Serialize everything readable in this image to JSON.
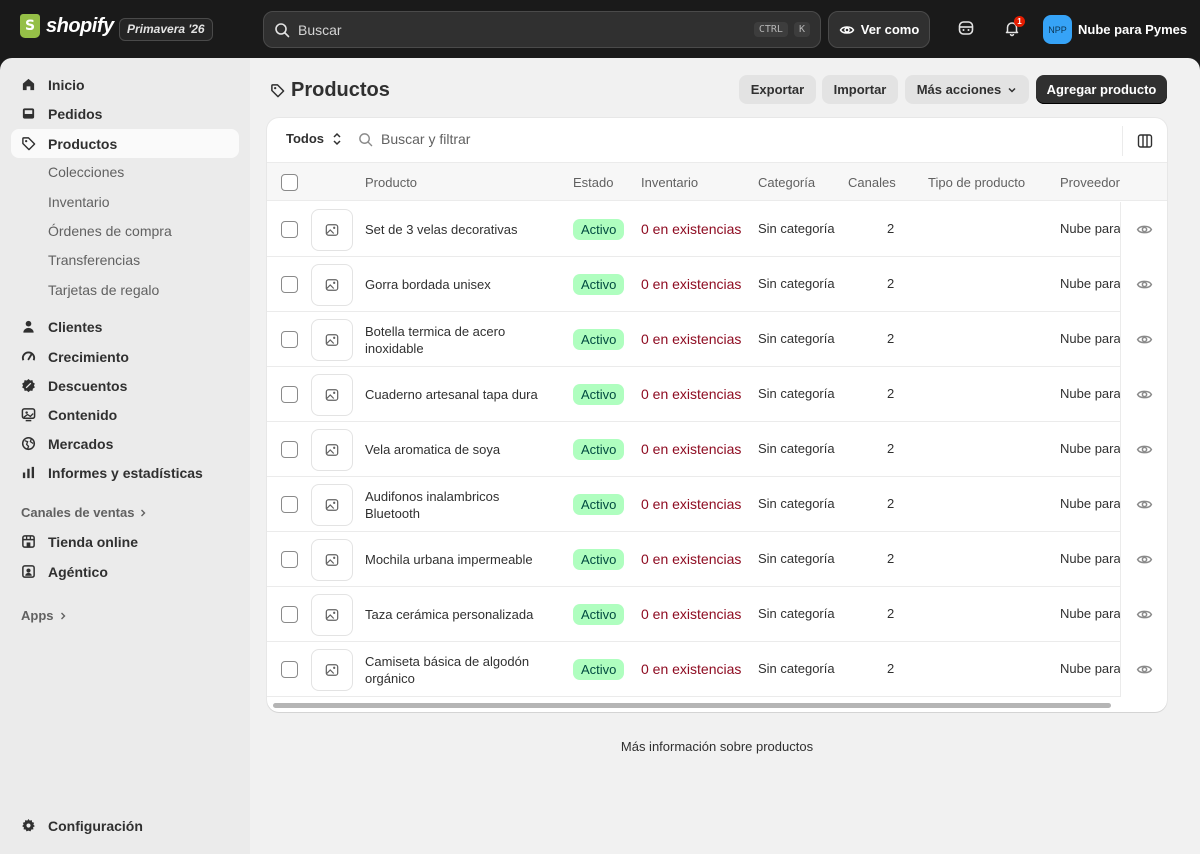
{
  "topbar": {
    "brand": "shopify",
    "edition": "Primavera '26",
    "search_placeholder": "Buscar",
    "shortcut_ctrl": "CTRL",
    "shortcut_k": "K",
    "view_as_label": "Ver como",
    "notification_count": "1",
    "store_initials": "NPP",
    "store_name": "Nube para Pymes"
  },
  "sidebar": {
    "items": [
      {
        "label": "Inicio",
        "icon": "home-icon"
      },
      {
        "label": "Pedidos",
        "icon": "inbox-icon"
      },
      {
        "label": "Productos",
        "icon": "tag-icon"
      },
      {
        "label": "Clientes",
        "icon": "person-icon"
      },
      {
        "label": "Crecimiento",
        "icon": "gauge-icon"
      },
      {
        "label": "Descuentos",
        "icon": "discount-icon"
      },
      {
        "label": "Contenido",
        "icon": "content-icon"
      },
      {
        "label": "Mercados",
        "icon": "globe-icon"
      },
      {
        "label": "Informes y estadísticas",
        "icon": "chart-icon"
      }
    ],
    "product_subitems": [
      "Colecciones",
      "Inventario",
      "Órdenes de compra",
      "Transferencias",
      "Tarjetas de regalo"
    ],
    "sales_channels_label": "Canales de ventas",
    "channels": [
      {
        "label": "Tienda online",
        "icon": "store-icon"
      },
      {
        "label": "Agéntico",
        "icon": "agent-icon"
      }
    ],
    "apps_label": "Apps",
    "settings_label": "Configuración"
  },
  "page": {
    "title": "Productos",
    "export_label": "Exportar",
    "import_label": "Importar",
    "more_actions_label": "Más acciones",
    "add_product_label": "Agregar producto"
  },
  "filters": {
    "tab_label": "Todos",
    "search_placeholder": "Buscar y filtrar"
  },
  "table": {
    "columns": [
      "Producto",
      "Estado",
      "Inventario",
      "Categoría",
      "Canales",
      "Tipo de producto",
      "Proveedor"
    ],
    "rows": [
      {
        "name": "Set de 3 velas decorativas",
        "status": "Activo",
        "inventory": "0 en existencias",
        "category": "Sin categoría",
        "channels": "2",
        "type": "",
        "vendor": "Nube para Pymes"
      },
      {
        "name": "Gorra bordada unisex",
        "status": "Activo",
        "inventory": "0 en existencias",
        "category": "Sin categoría",
        "channels": "2",
        "type": "",
        "vendor": "Nube para Pymes"
      },
      {
        "name": "Botella termica de acero inoxidable",
        "status": "Activo",
        "inventory": "0 en existencias",
        "category": "Sin categoría",
        "channels": "2",
        "type": "",
        "vendor": "Nube para Pymes"
      },
      {
        "name": "Cuaderno artesanal tapa dura",
        "status": "Activo",
        "inventory": "0 en existencias",
        "category": "Sin categoría",
        "channels": "2",
        "type": "",
        "vendor": "Nube para Pymes"
      },
      {
        "name": "Vela aromatica de soya",
        "status": "Activo",
        "inventory": "0 en existencias",
        "category": "Sin categoría",
        "channels": "2",
        "type": "",
        "vendor": "Nube para Pymes"
      },
      {
        "name": "Audifonos inalambricos Bluetooth",
        "status": "Activo",
        "inventory": "0 en existencias",
        "category": "Sin categoría",
        "channels": "2",
        "type": "",
        "vendor": "Nube para Pymes"
      },
      {
        "name": "Mochila urbana impermeable",
        "status": "Activo",
        "inventory": "0 en existencias",
        "category": "Sin categoría",
        "channels": "2",
        "type": "",
        "vendor": "Nube para Pymes"
      },
      {
        "name": "Taza cerámica personalizada",
        "status": "Activo",
        "inventory": "0 en existencias",
        "category": "Sin categoría",
        "channels": "2",
        "type": "",
        "vendor": "Nube para Pymes"
      },
      {
        "name": "Camiseta básica de algodón orgánico",
        "status": "Activo",
        "inventory": "0 en existencias",
        "category": "Sin categoría",
        "channels": "2",
        "type": "",
        "vendor": "Nube para Pymes"
      }
    ]
  },
  "footer": {
    "learn_more": "Más información sobre productos"
  },
  "colors": {
    "accent_dark": "#303030",
    "status_active_bg": "#affebf",
    "inventory_red": "#8e0b21"
  }
}
